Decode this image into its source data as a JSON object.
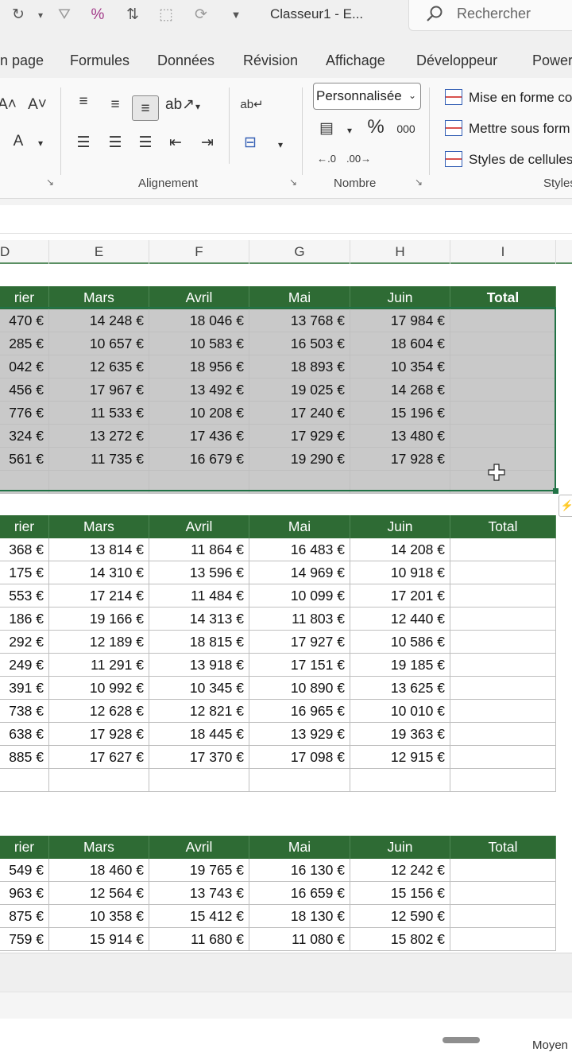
{
  "app": {
    "doc_title": "Classeur1  -  E...",
    "search_placeholder": "Rechercher"
  },
  "tabs": [
    "n page",
    "Formules",
    "Données",
    "Révision",
    "Affichage",
    "Développeur",
    "Power"
  ],
  "ribbon": {
    "alignment_label": "Alignement",
    "number_label": "Nombre",
    "styles_label": "Styles",
    "number_format": "Personnalisée",
    "styles": [
      "Mise en forme co",
      "Mettre sous form",
      "Styles de cellules"
    ],
    "thousands_label": "000"
  },
  "columns": [
    "D",
    "E",
    "F",
    "G",
    "H",
    "I"
  ],
  "table1": {
    "headers": [
      "rier",
      "Mars",
      "Avril",
      "Mai",
      "Juin",
      "Total"
    ],
    "rows": [
      [
        "470 €",
        "14 248 €",
        "18 046 €",
        "13 768 €",
        "17 984 €",
        ""
      ],
      [
        "285 €",
        "10 657 €",
        "10 583 €",
        "16 503 €",
        "18 604 €",
        ""
      ],
      [
        "042 €",
        "12 635 €",
        "18 956 €",
        "18 893 €",
        "10 354 €",
        ""
      ],
      [
        "456 €",
        "17 967 €",
        "13 492 €",
        "19 025 €",
        "14 268 €",
        ""
      ],
      [
        "776 €",
        "11 533 €",
        "10 208 €",
        "17 240 €",
        "15 196 €",
        ""
      ],
      [
        "324 €",
        "13 272 €",
        "17 436 €",
        "17 929 €",
        "13 480 €",
        ""
      ],
      [
        "561 €",
        "11 735 €",
        "16 679 €",
        "19 290 €",
        "17 928 €",
        ""
      ],
      [
        "",
        "",
        "",
        "",
        "",
        ""
      ]
    ]
  },
  "table2": {
    "headers": [
      "rier",
      "Mars",
      "Avril",
      "Mai",
      "Juin",
      "Total"
    ],
    "rows": [
      [
        "368 €",
        "13 814 €",
        "11 864 €",
        "16 483 €",
        "14 208 €",
        ""
      ],
      [
        "175 €",
        "14 310 €",
        "13 596 €",
        "14 969 €",
        "10 918 €",
        ""
      ],
      [
        "553 €",
        "17 214 €",
        "11 484 €",
        "10 099 €",
        "17 201 €",
        ""
      ],
      [
        "186 €",
        "19 166 €",
        "14 313 €",
        "11 803 €",
        "12 440 €",
        ""
      ],
      [
        "292 €",
        "12 189 €",
        "18 815 €",
        "17 927 €",
        "10 586 €",
        ""
      ],
      [
        "249 €",
        "11 291 €",
        "13 918 €",
        "17 151 €",
        "19 185 €",
        ""
      ],
      [
        "391 €",
        "10 992 €",
        "10 345 €",
        "10 890 €",
        "13 625 €",
        ""
      ],
      [
        "738 €",
        "12 628 €",
        "12 821 €",
        "16 965 €",
        "10 010 €",
        ""
      ],
      [
        "638 €",
        "17 928 €",
        "18 445 €",
        "13 929 €",
        "19 363 €",
        ""
      ],
      [
        "885 €",
        "17 627 €",
        "17 370 €",
        "17 098 €",
        "12 915 €",
        ""
      ],
      [
        "",
        "",
        "",
        "",
        "",
        ""
      ]
    ]
  },
  "table3": {
    "headers": [
      "rier",
      "Mars",
      "Avril",
      "Mai",
      "Juin",
      "Total"
    ],
    "rows": [
      [
        "549 €",
        "18 460 €",
        "19 765 €",
        "16 130 €",
        "12 242 €",
        ""
      ],
      [
        "963 €",
        "12 564 €",
        "13 743 €",
        "16 659 €",
        "15 156 €",
        ""
      ],
      [
        "875 €",
        "10 358 €",
        "15 412 €",
        "18 130 €",
        "12 590 €",
        ""
      ],
      [
        "759 €",
        "15 914 €",
        "11 680 €",
        "11 080 €",
        "15 802 €",
        ""
      ]
    ]
  },
  "status": {
    "text": "Moyen"
  },
  "colors": {
    "header_green": "#2e6b34",
    "selection_gray": "#c9c9c9",
    "excel_green": "#217346"
  }
}
